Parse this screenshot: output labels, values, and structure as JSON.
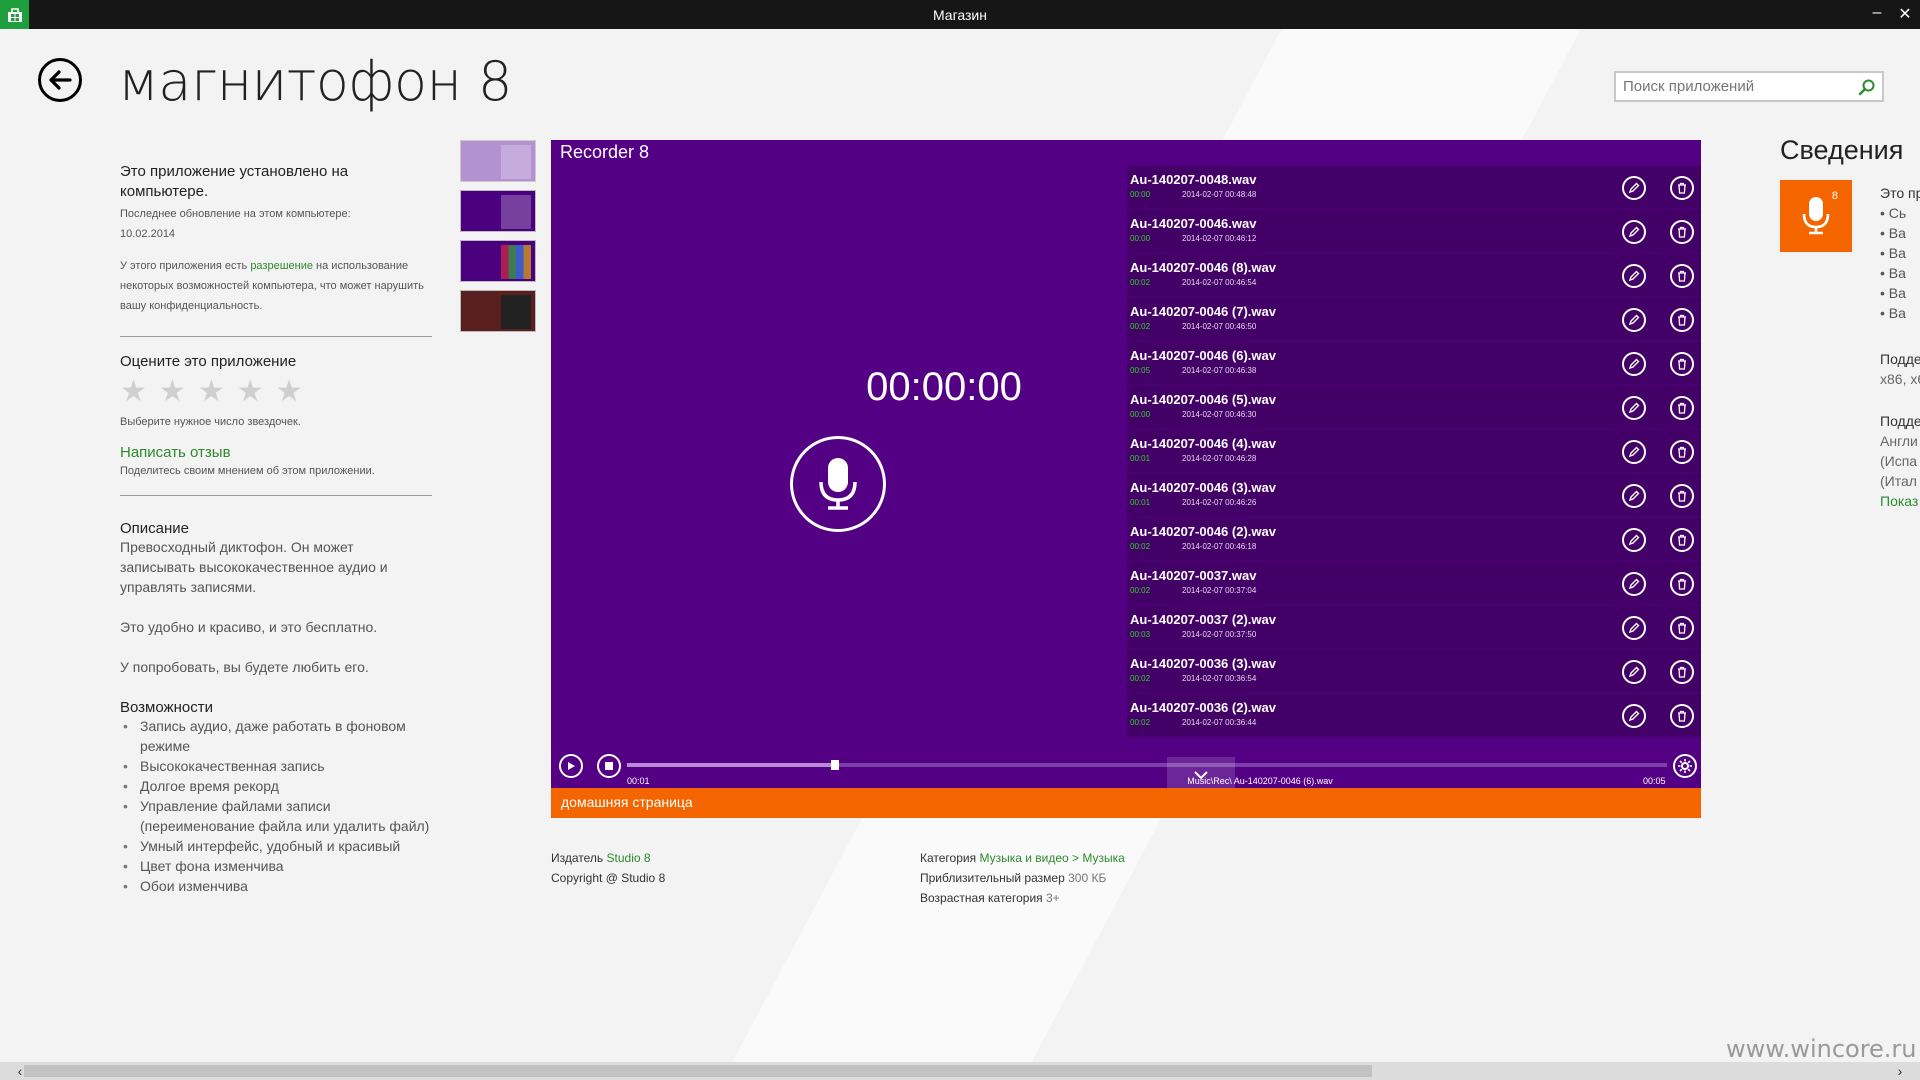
{
  "window": {
    "title": "Магазин",
    "minimize_glyph": "–",
    "close_glyph": "✕"
  },
  "header": {
    "page_title": "магнитофон 8",
    "back_icon": "back-arrow-icon"
  },
  "search": {
    "placeholder": "Поиск приложений",
    "icon": "search-icon"
  },
  "install_info": {
    "title": "Это приложение установлено на компьютере.",
    "last_update_label": "Последнее обновление на этом компьютере:",
    "last_update_date": "10.02.2014",
    "permission_pre": "У этого приложения есть",
    "permission_link": "разрешение",
    "permission_post": "на использование некоторых возможностей компьютера, что может нарушить вашу конфиденциальность."
  },
  "rating": {
    "title": "Оцените это приложение",
    "stars": [
      "★",
      "★",
      "★",
      "★",
      "★"
    ],
    "hint": "Выберите нужное число звездочек."
  },
  "review": {
    "link": "Написать отзыв",
    "hint": "Поделитесь своим мнением об этом приложении."
  },
  "description": {
    "title": "Описание",
    "paragraphs": [
      "Превосходный диктофон. Он может записывать высококачественное аудио и управлять записями.",
      "Это удобно и красиво, и это бесплатно.",
      "У попробовать, вы будете любить его."
    ]
  },
  "features": {
    "title": "Возможности",
    "items": [
      "Запись аудио, даже работать в фоновом режиме",
      "Высококачественная запись",
      "Долгое время рекорд",
      "Управление файлами записи (переименование файла или удалить файл)",
      "Умный интерфейс, удобный и красивый",
      "Цвет фона изменчива",
      "Обои изменчива"
    ]
  },
  "screenshot": {
    "app_title": "Recorder 8",
    "timer": "00:00:00",
    "recordings": [
      {
        "name": "Au-140207-0048.wav",
        "duration": "00:00",
        "date": "2014-02-07 00:48:48"
      },
      {
        "name": "Au-140207-0046.wav",
        "duration": "00:00",
        "date": "2014-02-07 00:46:12"
      },
      {
        "name": "Au-140207-0046 (8).wav",
        "duration": "00:02",
        "date": "2014-02-07 00:46:54"
      },
      {
        "name": "Au-140207-0046 (7).wav",
        "duration": "00:02",
        "date": "2014-02-07 00:46:50"
      },
      {
        "name": "Au-140207-0046 (6).wav",
        "duration": "00:05",
        "date": "2014-02-07 00:46:38"
      },
      {
        "name": "Au-140207-0046 (5).wav",
        "duration": "00:00",
        "date": "2014-02-07 00:46:30"
      },
      {
        "name": "Au-140207-0046 (4).wav",
        "duration": "00:01",
        "date": "2014-02-07 00:46:28"
      },
      {
        "name": "Au-140207-0046 (3).wav",
        "duration": "00:01",
        "date": "2014-02-07 00:46:26"
      },
      {
        "name": "Au-140207-0046 (2).wav",
        "duration": "00:02",
        "date": "2014-02-07 00:46:18"
      },
      {
        "name": "Au-140207-0037.wav",
        "duration": "00:02",
        "date": "2014-02-07 00:37:04"
      },
      {
        "name": "Au-140207-0037 (2).wav",
        "duration": "00:03",
        "date": "2014-02-07 00:37:50"
      },
      {
        "name": "Au-140207-0036 (3).wav",
        "duration": "00:02",
        "date": "2014-02-07 00:36:54"
      },
      {
        "name": "Au-140207-0036 (2).wav",
        "duration": "00:02",
        "date": "2014-02-07 00:36:44"
      }
    ],
    "player": {
      "elapsed": "00:01",
      "total": "00:05",
      "file_path": "Music\\Rec\\ Au-140207-0046 (6).wav",
      "progress": 0.2
    },
    "home_link": "домашняя страница"
  },
  "publisher": {
    "publisher_label": "Издатель",
    "publisher_name": "Studio 8",
    "copyright": "Copyright @ Studio 8",
    "category_label": "Категория",
    "category_main": "Музыка и видео",
    "category_sep": ">",
    "category_sub": "Музыка",
    "size_label": "Приблизительный размер",
    "size_value": "300 КБ",
    "age_label": "Возрастная категория",
    "age_value": "3+"
  },
  "details": {
    "title": "Сведения",
    "tile_sup": "8",
    "lines": {
      "app_line": "Это пр",
      "bullets": [
        "Сь",
        "Ва",
        "Ва",
        "Ва",
        "Ва",
        "Ва"
      ],
      "supported_title": "Подде",
      "arch": "x86, x6",
      "languages_title": "Подде",
      "langs": [
        "Англи",
        "(Испа",
        "(Итал"
      ],
      "show_more": "Показ"
    }
  },
  "watermark": "www.wincore.ru",
  "colors": {
    "accent": "#f46500",
    "purple": "#530085",
    "link_green": "#2d8a2d"
  }
}
